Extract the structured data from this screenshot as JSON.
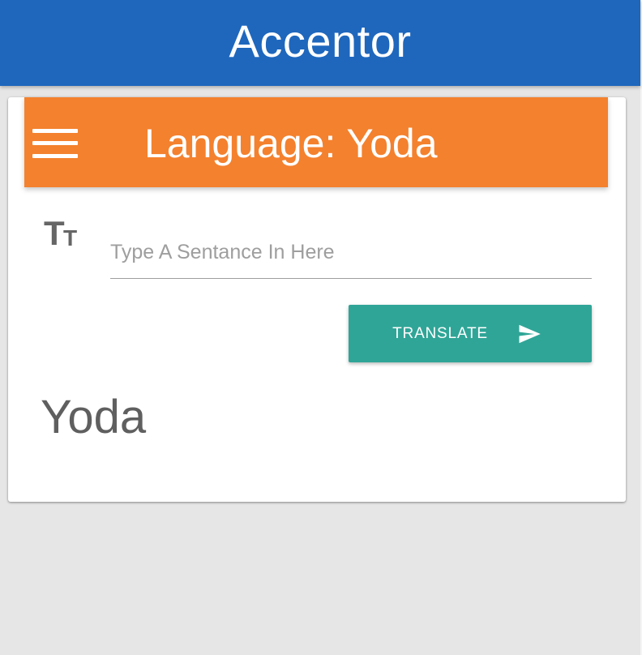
{
  "app_bar": {
    "title": "Accentor",
    "color": "#1e67bd"
  },
  "card": {
    "header": {
      "title": "Language: Yoda",
      "color": "#f4812e",
      "menu_icon": "hamburger-menu-icon"
    },
    "input": {
      "icon": "text-size-icon",
      "value": "",
      "placeholder": "Type A Sentance In Here"
    },
    "translate_button": {
      "label": "TRANSLATE",
      "icon": "send-icon",
      "color": "#2fa597"
    },
    "result": {
      "text": "Yoda"
    }
  }
}
